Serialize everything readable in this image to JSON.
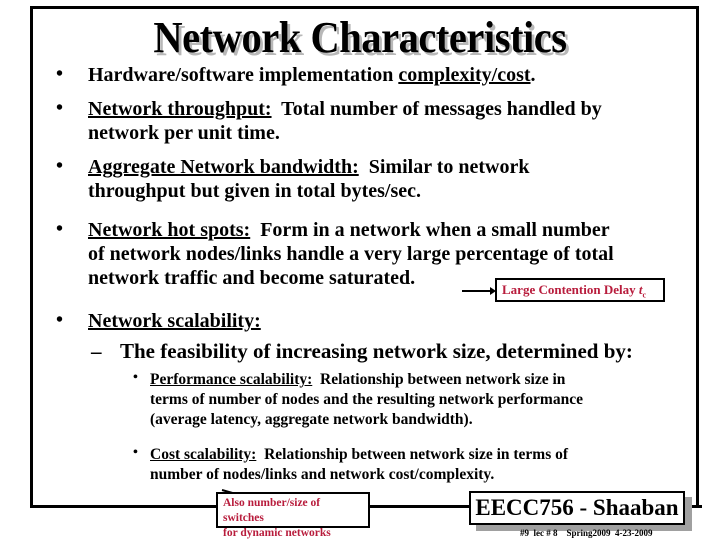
{
  "slide": {
    "title": "Network Characteristics",
    "bullets": [
      {
        "term": "",
        "line1_prefix": "Hardware/software implementation ",
        "line1_term": "complexity/cost",
        "line1_suffix": "."
      },
      {
        "term": "Network throughput:",
        "line1": "  Total number of messages handled by",
        "line2": "network per unit time."
      },
      {
        "term": "Aggregate Network bandwidth:",
        "line1": "  Similar to network",
        "line2": "throughput but given in total bytes/sec."
      },
      {
        "term": "Network hot spots:",
        "line1": "  Form in a network when a small number",
        "line2": "of network nodes/links handle a very large percentage of total",
        "line3": "network traffic and become saturated."
      },
      {
        "term": "Network scalability:",
        "sub": "The feasibility of increasing network size, determined by:",
        "subsub": [
          {
            "term": "Performance scalability:",
            "line1": "  Relationship between network size in",
            "line2": "terms of number of nodes and the resulting network performance",
            "line3": "(average latency, aggregate network bandwidth)."
          },
          {
            "term": "Cost scalability:",
            "line1": "  Relationship between network size in terms of",
            "line2": "number of nodes/links and network cost/complexity."
          }
        ]
      }
    ],
    "bullet_glyph": "•",
    "dash_glyph": "–",
    "callout": {
      "text": "Large Contention Delay ",
      "symbol": "t",
      "subscript": "c"
    },
    "note": {
      "line1": "Also number/size of switches",
      "line2": "for dynamic networks"
    },
    "footer": {
      "label": "EECC756 - Shaaban",
      "info": "#9  lec # 8    Spring2009  4-23-2009"
    },
    "colors": {
      "accent": "#b81c3c",
      "shadow": "#a0a0a0"
    }
  }
}
